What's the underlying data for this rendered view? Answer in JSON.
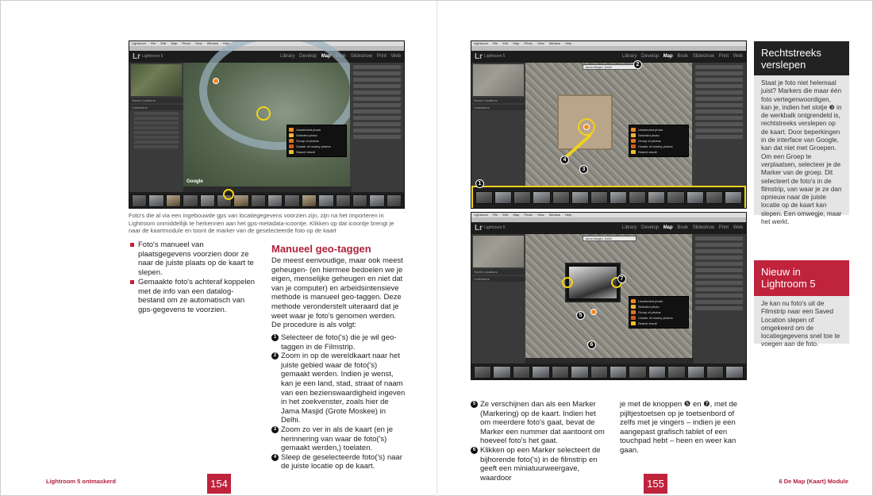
{
  "lightroom": {
    "menu": [
      "Lightroom",
      "File",
      "Edit",
      "Map",
      "Photo",
      "View",
      "Window",
      "Help"
    ],
    "logo": "Lr",
    "logo_sub": "Lightroom 5",
    "modules": [
      "Library",
      "Develop",
      "Map",
      "Book",
      "Slideshow",
      "Print",
      "Web"
    ],
    "active_module": "Map",
    "legend": [
      "Unselected photo",
      "Selected photo",
      "Group of photos",
      "Cluster of nearby photos",
      "Search result"
    ],
    "search_field": "Jama Masjid, Delhi",
    "google": "Google",
    "panel_saved": "Saved Locations",
    "panel_collections": "Collections",
    "panel_navigator": "Navigator"
  },
  "left_page": {
    "caption": "Foto's die al via een ingebouwde gps van locatiegegevens voorzien zijn, zijn na het importeren in Lightroom onmiddellijk te herkennen aan het gps-metadata-icoontje. Klikken op dat icoontje brengt je naar de kaartmodule en toont de marker van de geselecteerde foto op de kaart",
    "bullets": [
      "Foto's manueel van plaatsgegevens voorzien door ze naar de juiste plaats op de kaart te slepen.",
      "Gemaakte foto's achteraf koppelen met de info van een datalog-bestand om ze automatisch van gps-gegevens te voorzien."
    ],
    "heading": "Manueel geo-taggen",
    "intro": "De meest eenvoudige, maar ook meest geheugen- (en hiermee bedoelen we je eigen, menselijke geheugen en niet dat van je computer) en arbeidsintensieve methode is manueel geo-taggen. Deze methode veronderstelt uiteraard dat je weet waar je foto's genomen werden. De procedure is als volgt:",
    "steps": [
      {
        "n": "1",
        "text": "Selecteer de foto('s) die je wil geo-taggen in de Filmstrip."
      },
      {
        "n": "2",
        "text": "Zoom in op de wereldkaart naar het juiste gebied waar de foto('s) gemaakt werden. Indien je wenst, kan je een land, stad, straat of naam van een bezienswaardigheid ingeven in het zoekvenster, zoals hier de Jama Masjid (Grote Moskee) in Delhi."
      },
      {
        "n": "3",
        "text": "Zoom zo ver in als de kaart (en je herinnering van waar de foto('s) gemaakt werden,) toelaten."
      },
      {
        "n": "4",
        "text": "Sleep de geselecteerde foto('s) naar de juiste locatie op de kaart."
      }
    ],
    "footer": "Lightroom 5 ontmaskerd",
    "page_number": "154"
  },
  "right_page": {
    "steps_col1": [
      {
        "n": "5",
        "text": "Ze verschijnen dan als een Marker (Markering) op de kaart. Indien het om meerdere foto's gaat, bevat de Marker een nummer dat aantoont om hoeveel foto's het gaat."
      },
      {
        "n": "6",
        "text": "Klikken op een Marker selecteert de bijhorende foto('s) in de filmstrip en geeft een miniatuurweergave, waardoor"
      }
    ],
    "col2": "je met de knoppen ❺ en ❼, met de pijltjestoetsen op je toetsenbord of zelfs met je vingers – indien je een aangepast grafisch tablet of een touchpad hebt – heen en weer kan gaan.",
    "box1_title": "Rechtstreeks verslepen",
    "box1_text": "Staat je foto niet helemaal juist? Markers die maar één foto vertegenwoordigen, kan je, indien het slotje ❸ in de werkbalk ontgrendeld is, rechtstreeks verslepen op de kaart. Door beperkingen in de interface van Google, kan dat niet met Groepen. Om een Groep te verplaatsen, selecteer je de Marker van de groep. Dit selecteert de foto's in de filmstrip, van waar je ze dan opnieuw naar de juiste locatie op de kaart kan slepen. Een omwegje, maar het werkt.",
    "box2_title": "Nieuw in Lightroom 5",
    "box2_text": "Je kan nu foto's uit de Filmstrip naar een Saved Location slepen of omgekeerd om de locatiegegevens snel toe te voegen aan de foto.",
    "footer": "6  De Map (Kaart) Module",
    "page_number": "155",
    "badges": [
      "1",
      "2",
      "3",
      "4",
      "5",
      "6",
      "7"
    ]
  },
  "colors": {
    "accent": "#c0233c",
    "sidebar_dark": "#222222",
    "highlight": "#f4d11c",
    "marker": "#f28a1e"
  }
}
